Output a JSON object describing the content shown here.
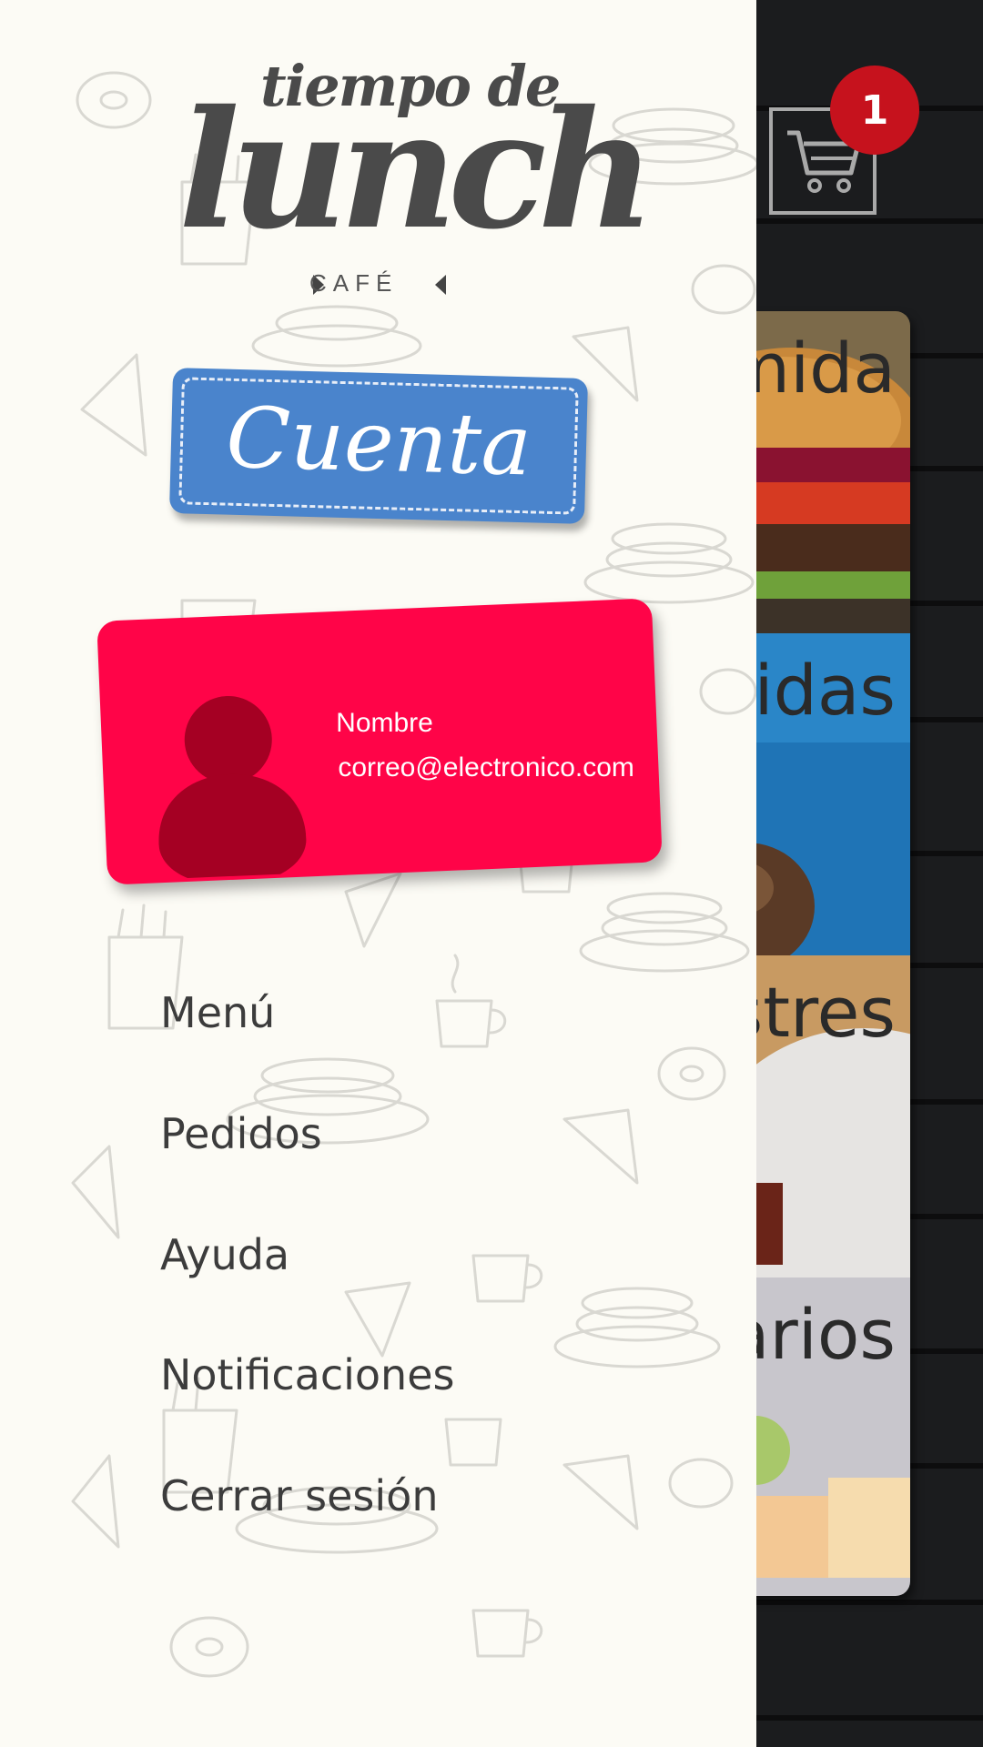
{
  "cart": {
    "badge_count": "1"
  },
  "categories": [
    {
      "label": "Comida"
    },
    {
      "label": "Bebidas"
    },
    {
      "label": "Postres"
    },
    {
      "label": "Varios"
    }
  ],
  "logo": {
    "line1": "tiempo de",
    "line2": "lunch",
    "line3": "CAFÉ"
  },
  "account": {
    "title": "Cuenta"
  },
  "profile": {
    "name": "Nombre",
    "email": "correo@electronico.com"
  },
  "menu": {
    "items": [
      {
        "label": "Menú"
      },
      {
        "label": "Pedidos"
      },
      {
        "label": "Ayuda"
      },
      {
        "label": "Notificaciones"
      },
      {
        "label": "Cerrar sesión"
      }
    ]
  },
  "colors": {
    "drawer_bg": "#fcfbf5",
    "account_badge": "#4a84cc",
    "profile_card": "#ff0448",
    "avatar": "#a50023",
    "cart_badge": "#c6121d",
    "app_bg": "#1b1c1e"
  },
  "icons": [
    "cart-icon",
    "avatar-icon"
  ]
}
